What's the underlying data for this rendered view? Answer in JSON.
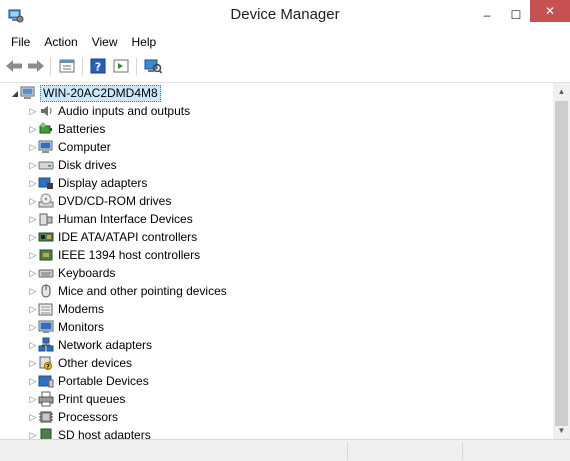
{
  "window": {
    "title": "Device Manager",
    "controls": {
      "minimize": "–",
      "maximize": "☐",
      "close": "✕"
    }
  },
  "menu": [
    "File",
    "Action",
    "View",
    "Help"
  ],
  "toolbar": [
    {
      "name": "back-arrow-icon"
    },
    {
      "name": "forward-arrow-icon"
    },
    {
      "name": "properties-icon"
    },
    {
      "name": "help-icon"
    },
    {
      "name": "show-hidden-icon"
    },
    {
      "name": "scan-hardware-icon"
    }
  ],
  "tree": {
    "root": {
      "label": "WIN-20AC2DMD4M8",
      "expander": "◢"
    },
    "expander_glyph": "▷",
    "items": [
      {
        "label": "Audio inputs and outputs",
        "icon": "speaker-icon"
      },
      {
        "label": "Batteries",
        "icon": "battery-icon"
      },
      {
        "label": "Computer",
        "icon": "computer-icon"
      },
      {
        "label": "Disk drives",
        "icon": "disk-drive-icon"
      },
      {
        "label": "Display adapters",
        "icon": "display-adapter-icon"
      },
      {
        "label": "DVD/CD-ROM drives",
        "icon": "dvd-icon"
      },
      {
        "label": "Human Interface Devices",
        "icon": "hid-icon"
      },
      {
        "label": "IDE ATA/ATAPI controllers",
        "icon": "ide-controller-icon"
      },
      {
        "label": "IEEE 1394 host controllers",
        "icon": "ieee1394-icon"
      },
      {
        "label": "Keyboards",
        "icon": "keyboard-icon"
      },
      {
        "label": "Mice and other pointing devices",
        "icon": "mouse-icon"
      },
      {
        "label": "Modems",
        "icon": "modem-icon"
      },
      {
        "label": "Monitors",
        "icon": "monitor-icon"
      },
      {
        "label": "Network adapters",
        "icon": "network-adapter-icon"
      },
      {
        "label": "Other devices",
        "icon": "other-devices-icon"
      },
      {
        "label": "Portable Devices",
        "icon": "portable-device-icon"
      },
      {
        "label": "Print queues",
        "icon": "printer-icon"
      },
      {
        "label": "Processors",
        "icon": "processor-icon"
      },
      {
        "label": "SD host adapters",
        "icon": "sd-adapter-icon"
      }
    ]
  },
  "scrollbar": {
    "up": "▲",
    "down": "▼"
  },
  "colors": {
    "selection": "#cce8ff",
    "close_button": "#c75050"
  }
}
